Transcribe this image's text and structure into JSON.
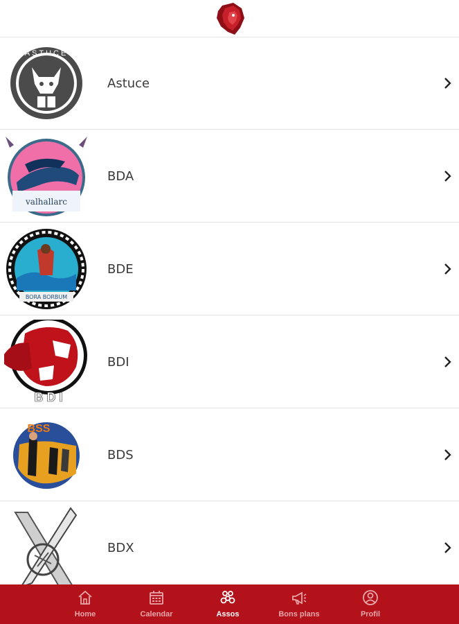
{
  "associations": [
    {
      "name": "Astuce"
    },
    {
      "name": "BDA",
      "logo_text": "valhallarc"
    },
    {
      "name": "BDE",
      "logo_text": "BORA BORBUM"
    },
    {
      "name": "BDI",
      "logo_text": "B D I"
    },
    {
      "name": "BDS",
      "logo_text": "BSS"
    },
    {
      "name": "BDX"
    }
  ],
  "astuce_logo_text": "ASTUCE",
  "tabs": [
    {
      "label": "Home",
      "icon": "home-icon",
      "active": false
    },
    {
      "label": "Calendar",
      "icon": "calendar-icon",
      "active": false
    },
    {
      "label": "Assos",
      "icon": "assos-icon",
      "active": true
    },
    {
      "label": "Bons plans",
      "icon": "megaphone-icon",
      "active": false
    },
    {
      "label": "Profil",
      "icon": "profile-icon",
      "active": false
    }
  ],
  "colors": {
    "accent": "#b3121b",
    "tab_inactive": "#e8a7aa",
    "tab_active": "#ffffff"
  }
}
